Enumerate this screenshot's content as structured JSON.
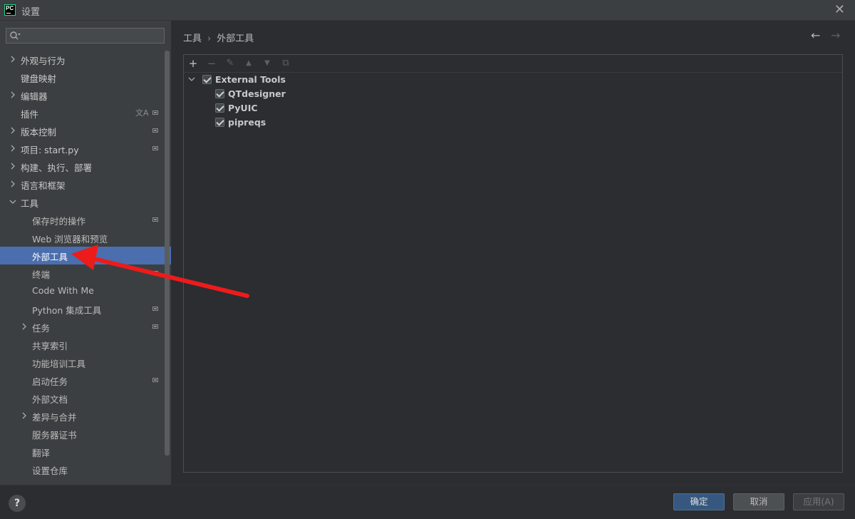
{
  "window": {
    "title": "设置",
    "logo_text": "PC"
  },
  "search": {
    "placeholder": "",
    "value": ""
  },
  "sidebar": {
    "items": [
      {
        "label": "外观与行为",
        "expandable": true,
        "expanded": false,
        "level": 0,
        "proj": false
      },
      {
        "label": "键盘映射",
        "expandable": false,
        "level": 0,
        "proj": false
      },
      {
        "label": "编辑器",
        "expandable": true,
        "expanded": false,
        "level": 0,
        "proj": false
      },
      {
        "label": "插件",
        "expandable": false,
        "level": 0,
        "proj": true,
        "translate": true
      },
      {
        "label": "版本控制",
        "expandable": true,
        "expanded": false,
        "level": 0,
        "proj": true
      },
      {
        "label": "项目: start.py",
        "expandable": true,
        "expanded": false,
        "level": 0,
        "proj": true
      },
      {
        "label": "构建、执行、部署",
        "expandable": true,
        "expanded": false,
        "level": 0,
        "proj": false
      },
      {
        "label": "语言和框架",
        "expandable": true,
        "expanded": false,
        "level": 0,
        "proj": false
      },
      {
        "label": "工具",
        "expandable": true,
        "expanded": true,
        "level": 0,
        "proj": false
      },
      {
        "label": "保存时的操作",
        "expandable": false,
        "level": 1,
        "proj": true
      },
      {
        "label": "Web 浏览器和预览",
        "expandable": false,
        "level": 1,
        "proj": false
      },
      {
        "label": "外部工具",
        "expandable": false,
        "level": 1,
        "proj": false,
        "selected": true
      },
      {
        "label": "终端",
        "expandable": false,
        "level": 1,
        "proj": true
      },
      {
        "label": "Code With Me",
        "expandable": false,
        "level": 1,
        "proj": false
      },
      {
        "label": "Python 集成工具",
        "expandable": false,
        "level": 1,
        "proj": true
      },
      {
        "label": "任务",
        "expandable": true,
        "expanded": false,
        "level": 1,
        "proj": true
      },
      {
        "label": "共享索引",
        "expandable": false,
        "level": 1,
        "proj": false
      },
      {
        "label": "功能培训工具",
        "expandable": false,
        "level": 1,
        "proj": false
      },
      {
        "label": "启动任务",
        "expandable": false,
        "level": 1,
        "proj": true
      },
      {
        "label": "外部文档",
        "expandable": false,
        "level": 1,
        "proj": false
      },
      {
        "label": "差异与合并",
        "expandable": true,
        "expanded": false,
        "level": 1,
        "proj": false
      },
      {
        "label": "服务器证书",
        "expandable": false,
        "level": 1,
        "proj": false
      },
      {
        "label": "翻译",
        "expandable": false,
        "level": 1,
        "proj": false
      },
      {
        "label": "设置仓库",
        "expandable": false,
        "level": 1,
        "proj": false
      }
    ],
    "translate_glyph": "文A"
  },
  "breadcrumb": {
    "parent": "工具",
    "separator": "›",
    "current": "外部工具"
  },
  "toolbar": {
    "add": {
      "glyph": "+",
      "enabled": true
    },
    "remove": {
      "glyph": "−",
      "enabled": false
    },
    "edit": {
      "glyph": "✎",
      "enabled": false
    },
    "up": {
      "glyph": "▲",
      "enabled": false
    },
    "down": {
      "glyph": "▼",
      "enabled": false
    },
    "copy": {
      "glyph": "⧉",
      "enabled": false
    }
  },
  "tools_tree": {
    "group": {
      "label": "External Tools",
      "checked": true,
      "expanded": true
    },
    "items": [
      {
        "label": "QTdesigner",
        "checked": true
      },
      {
        "label": "PyUIC",
        "checked": true
      },
      {
        "label": "pipreqs",
        "checked": true
      }
    ]
  },
  "footer": {
    "help": "?",
    "ok": "确定",
    "cancel": "取消",
    "apply": "应用(A)"
  },
  "colors": {
    "selection": "#4b6eaf",
    "annotation_arrow": "#ee1b1b",
    "primary_button": "#365880"
  }
}
